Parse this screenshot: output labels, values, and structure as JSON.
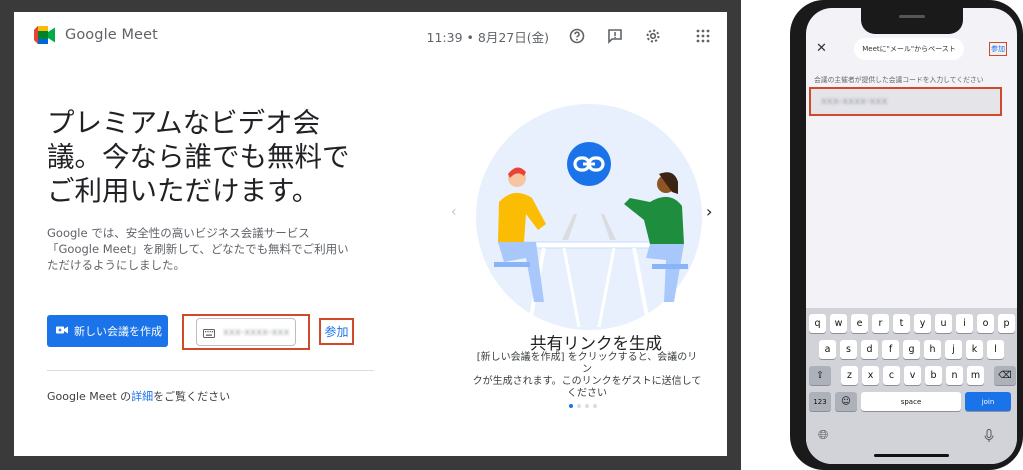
{
  "desktop": {
    "logo_text": "Google Meet",
    "header": {
      "datetime": "11:39 • 8月27日(金)"
    },
    "hero_lines": [
      "プレミアムなビデオ会",
      "議。今なら誰でも無料で",
      "ご利用いただけます。"
    ],
    "desc_lines": [
      "Google では、安全性の高いビジネス会議サービス",
      "「Google Meet」を刷新して、どなたでも無料でご利用い",
      "ただけるようにしました。"
    ],
    "new_meeting_label": "新しい会議を作成",
    "code_input_value": "xxx-xxxx-xxx",
    "join_label": "参加",
    "footer": {
      "prefix": "Google Meet の",
      "link": "詳細",
      "suffix": "をご覧ください"
    },
    "carousel": {
      "title": "共有リンクを生成",
      "desc_lines": [
        "[新しい会議を作成] をクリックすると、会議のリン",
        "クが生成されます。このリンクをゲストに送信して",
        "ください"
      ],
      "prev_icon": "chevron-left-icon",
      "next_icon": "chevron-right-icon",
      "page_count": 4,
      "active_page": 1
    },
    "colors": {
      "primary": "#1a73e8",
      "highlight": "#d04a2a"
    }
  },
  "phone": {
    "close_icon": "close-icon",
    "paste_label": "Meetに\"メール\"からペースト",
    "join_label": "参加",
    "hint": "会議の主催者が提供した会議コードを入力してください",
    "input_value": "xxx-xxxx-xxx",
    "keyboard": {
      "row1": [
        "q",
        "w",
        "e",
        "r",
        "t",
        "y",
        "u",
        "i",
        "o",
        "p"
      ],
      "row2": [
        "a",
        "s",
        "d",
        "f",
        "g",
        "h",
        "j",
        "k",
        "l"
      ],
      "row3": [
        "z",
        "x",
        "c",
        "v",
        "b",
        "n",
        "m"
      ],
      "numbers": "123",
      "space": "space",
      "go": "join"
    }
  }
}
